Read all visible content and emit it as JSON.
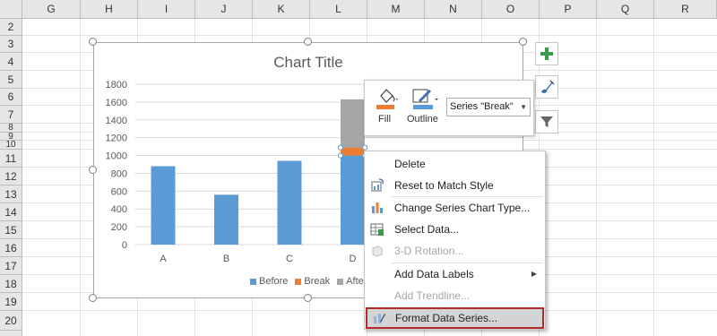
{
  "columns": [
    "G",
    "H",
    "I",
    "J",
    "K",
    "L",
    "M",
    "N",
    "O",
    "P",
    "Q",
    "R"
  ],
  "rows": [
    "2",
    "3",
    "4",
    "5",
    "6",
    "7",
    "8",
    "9",
    "10",
    "11",
    "12",
    "13",
    "14",
    "15",
    "16",
    "17",
    "18",
    "19",
    "20"
  ],
  "chart": {
    "title": "Chart Title",
    "legend": [
      {
        "name": "Before",
        "color": "#5b9bd5"
      },
      {
        "name": "Break",
        "color": "#ed7d31"
      },
      {
        "name": "Afte",
        "color": "#a5a5a5"
      }
    ]
  },
  "chart_data": {
    "type": "bar",
    "stacked": true,
    "title": "Chart Title",
    "categories": [
      "A",
      "B",
      "C",
      "D"
    ],
    "series": [
      {
        "name": "Before",
        "values": [
          880,
          560,
          940,
          1000
        ]
      },
      {
        "name": "Break",
        "values": [
          0,
          0,
          0,
          90
        ]
      },
      {
        "name": "After",
        "values": [
          0,
          0,
          0,
          540
        ]
      }
    ],
    "ylim": [
      0,
      1800
    ],
    "yticks": [
      "0",
      "200",
      "400",
      "600",
      "800",
      "1000",
      "1200",
      "1400",
      "1600",
      "1800"
    ],
    "grid": true,
    "legend_position": "bottom"
  },
  "side_buttons": {
    "elements": "chart-elements-icon",
    "styles": "chart-styles-icon",
    "filters": "chart-filters-icon"
  },
  "mini_toolbar": {
    "fill_label": "Fill",
    "outline_label": "Outline",
    "series_select": "Series \"Break\""
  },
  "context_menu": {
    "items": [
      {
        "label": "Delete",
        "disabled": false,
        "icon": ""
      },
      {
        "label": "Reset to Match Style",
        "disabled": false,
        "icon": "reset-style-icon"
      },
      {
        "label": "Change Series Chart Type...",
        "disabled": false,
        "icon": "chart-type-icon"
      },
      {
        "label": "Select Data...",
        "disabled": false,
        "icon": "select-data-icon"
      },
      {
        "label": "3-D Rotation...",
        "disabled": true,
        "icon": "rotation-3d-icon"
      },
      {
        "label": "Add Data Labels",
        "disabled": false,
        "icon": ""
      },
      {
        "label": "Add Trendline...",
        "disabled": true,
        "icon": ""
      },
      {
        "label": "Format Data Series...",
        "disabled": false,
        "icon": "format-series-icon"
      }
    ]
  }
}
